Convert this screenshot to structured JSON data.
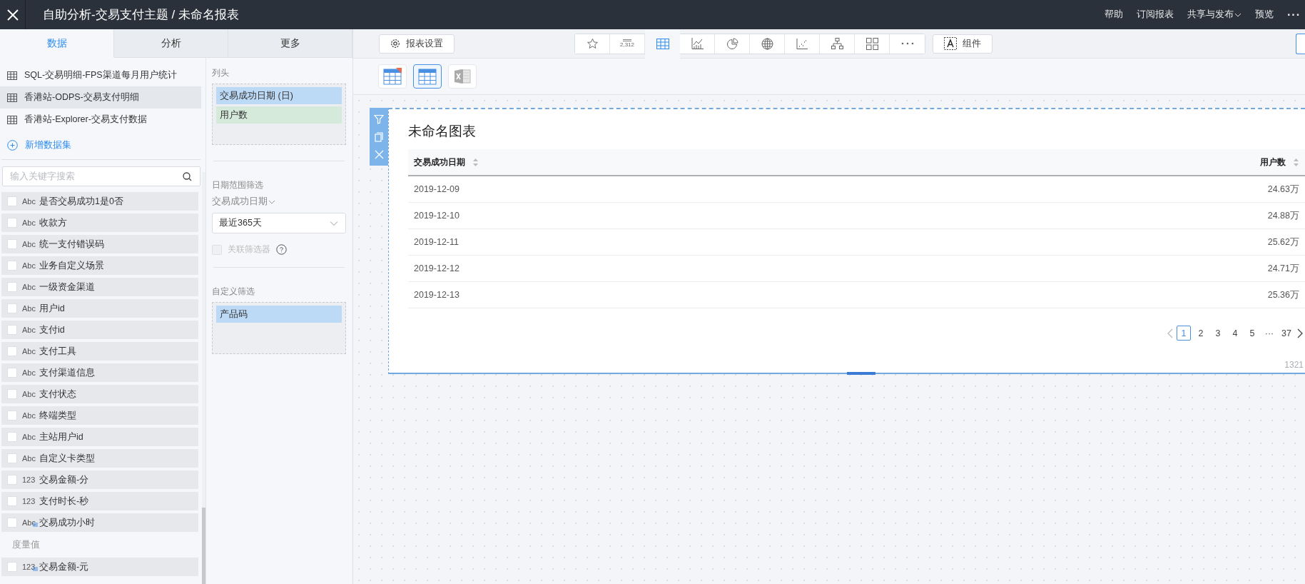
{
  "topbar": {
    "title": "自助分析-交易支付主题 / 未命名报表",
    "actions": [
      {
        "label": "帮助",
        "dropdown": false
      },
      {
        "label": "订阅报表",
        "dropdown": false
      },
      {
        "label": "共享与发布",
        "dropdown": true
      },
      {
        "label": "预览",
        "dropdown": false
      }
    ],
    "more": "···"
  },
  "panel_tabs": [
    {
      "label": "数据",
      "selected": true
    },
    {
      "label": "分析",
      "selected": false
    },
    {
      "label": "更多",
      "selected": false
    }
  ],
  "datasets": [
    {
      "label": "SQL-交易明细-FPS渠道每月用户统计",
      "selected": false
    },
    {
      "label": "香港站-ODPS-交易支付明细",
      "selected": true
    },
    {
      "label": "香港站-Explorer-交易支付数据",
      "selected": false
    }
  ],
  "add_dataset": "新增数据集",
  "search": {
    "placeholder": "输入关键字搜索"
  },
  "fields": [
    {
      "type_label": "Abc",
      "derived": false,
      "label": "是否交易成功1是0否",
      "checked": false
    },
    {
      "type_label": "Abc",
      "derived": false,
      "label": "收款方",
      "checked": false
    },
    {
      "type_label": "Abc",
      "derived": false,
      "label": "统一支付错误码",
      "checked": false
    },
    {
      "type_label": "Abc",
      "derived": false,
      "label": "业务自定义场景",
      "checked": false
    },
    {
      "type_label": "Abc",
      "derived": false,
      "label": "一级资金渠道",
      "checked": false
    },
    {
      "type_label": "Abc",
      "derived": false,
      "label": "用户id",
      "checked": false
    },
    {
      "type_label": "Abc",
      "derived": false,
      "label": "支付id",
      "checked": false
    },
    {
      "type_label": "Abc",
      "derived": false,
      "label": "支付工具",
      "checked": false
    },
    {
      "type_label": "Abc",
      "derived": false,
      "label": "支付渠道信息",
      "checked": false
    },
    {
      "type_label": "Abc",
      "derived": false,
      "label": "支付状态",
      "checked": false
    },
    {
      "type_label": "Abc",
      "derived": false,
      "label": "终端类型",
      "checked": false
    },
    {
      "type_label": "Abc",
      "derived": false,
      "label": "主站用户id",
      "checked": false
    },
    {
      "type_label": "Abc",
      "derived": false,
      "label": "自定义卡类型",
      "checked": false
    },
    {
      "type_label": "123",
      "derived": false,
      "label": "交易金额-分",
      "checked": false
    },
    {
      "type_label": "123",
      "derived": false,
      "label": "支付时长-秒",
      "checked": false
    },
    {
      "type_label": "Abc",
      "derived": true,
      "label": "交易成功小时",
      "checked": false
    }
  ],
  "measures_heading": "度量值",
  "measures": [
    {
      "type_label": "123",
      "derived": true,
      "label": "交易金额-元",
      "checked": false
    }
  ],
  "columns_section": {
    "title": "列头",
    "chips": [
      {
        "label": "交易成功日期 (日)",
        "kind": "dimension"
      },
      {
        "label": "用户数",
        "kind": "measure"
      }
    ]
  },
  "date_filter": {
    "title": "日期范围筛选",
    "field": "交易成功日期",
    "value": "最近365天",
    "link_label": "关联筛选器",
    "link_checked": false
  },
  "custom_filter": {
    "title": "自定义筛选",
    "chips": [
      {
        "label": "产品码"
      }
    ]
  },
  "report_settings": "报表设置",
  "chart_types": [
    {
      "kind": "star",
      "selected": false
    },
    {
      "kind": "kpi",
      "label": "2,312",
      "selected": false
    },
    {
      "kind": "table",
      "selected": true
    },
    {
      "kind": "line",
      "selected": false
    },
    {
      "kind": "pie",
      "selected": false
    },
    {
      "kind": "globe",
      "selected": false
    },
    {
      "kind": "scatter",
      "selected": false
    },
    {
      "kind": "tree",
      "selected": false
    },
    {
      "kind": "grid",
      "selected": false
    },
    {
      "kind": "more",
      "selected": false
    }
  ],
  "component_button": "组件",
  "table_styles": [
    {
      "kind": "new",
      "selected": false
    },
    {
      "kind": "plain",
      "selected": true
    },
    {
      "kind": "excel",
      "selected": false
    }
  ],
  "chart": {
    "title": "未命名图表",
    "columns": [
      "交易成功日期",
      "用户数"
    ],
    "rows": [
      [
        "2019-12-09",
        "24.63万"
      ],
      [
        "2019-12-10",
        "24.88万"
      ],
      [
        "2019-12-11",
        "25.62万"
      ],
      [
        "2019-12-12",
        "24.71万"
      ],
      [
        "2019-12-13",
        "25.36万"
      ]
    ],
    "pages": [
      {
        "label": "1",
        "selected": true
      },
      {
        "label": "2",
        "selected": false
      },
      {
        "label": "3",
        "selected": false
      },
      {
        "label": "4",
        "selected": false
      },
      {
        "label": "5",
        "selected": false
      },
      {
        "label": "···",
        "selected": false
      },
      {
        "label": "37",
        "selected": false
      }
    ],
    "size": "1321"
  }
}
